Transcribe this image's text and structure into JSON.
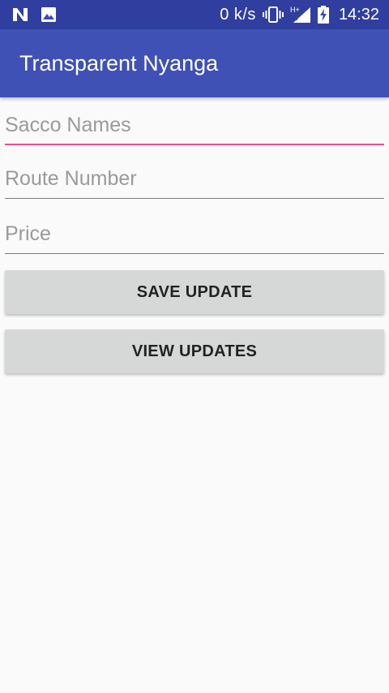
{
  "status_bar": {
    "network_speed": "0 k/s",
    "network_type": "H+",
    "time": "14:32",
    "icons": [
      "n-notification-icon",
      "image-notification-icon",
      "vibrate-icon",
      "signal-icon",
      "battery-charging-icon"
    ]
  },
  "app_bar": {
    "title": "Transparent Nyanga"
  },
  "form": {
    "sacco_names": {
      "value": "",
      "placeholder": "Sacco Names",
      "focused": true
    },
    "route_number": {
      "value": "",
      "placeholder": "Route Number"
    },
    "price": {
      "value": "",
      "placeholder": "Price"
    }
  },
  "buttons": {
    "save_label": "SAVE UPDATE",
    "view_label": "VIEW UPDATES"
  },
  "colors": {
    "status_bar": "#303f9f",
    "app_bar": "#3f51b5",
    "accent": "#e94f85",
    "background": "#fafafa",
    "button": "#d6d7d7"
  }
}
